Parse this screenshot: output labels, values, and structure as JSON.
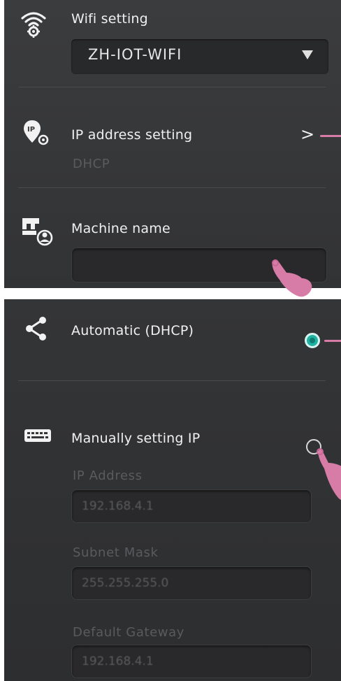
{
  "wifi": {
    "label": "Wifi setting",
    "selected": "ZH-IOT-WIFI",
    "icon": "wifi-gear-icon"
  },
  "ip_setting": {
    "label": "IP address setting",
    "value": "DHCP",
    "icon": "ip-location-gear-icon",
    "chevron": ">"
  },
  "machine": {
    "label": "Machine name",
    "value": "",
    "icon": "sewing-machine-user-icon"
  },
  "dhcp": {
    "label": "Automatic (DHCP)",
    "icon": "share-icon",
    "selected": true
  },
  "manual": {
    "label": "Manually setting IP",
    "icon": "keyboard-icon",
    "selected": false,
    "fields": [
      {
        "label": "IP Address",
        "value": "192.168.4.1"
      },
      {
        "label": "Subnet Mask",
        "value": "255.255.255.0"
      },
      {
        "label": "Default Gateway",
        "value": "192.168.4.1"
      }
    ]
  },
  "colors": {
    "accent_pointer": "#d77ca6",
    "radio_selected": "#1fb3a3",
    "panel_bg": "#363739"
  }
}
